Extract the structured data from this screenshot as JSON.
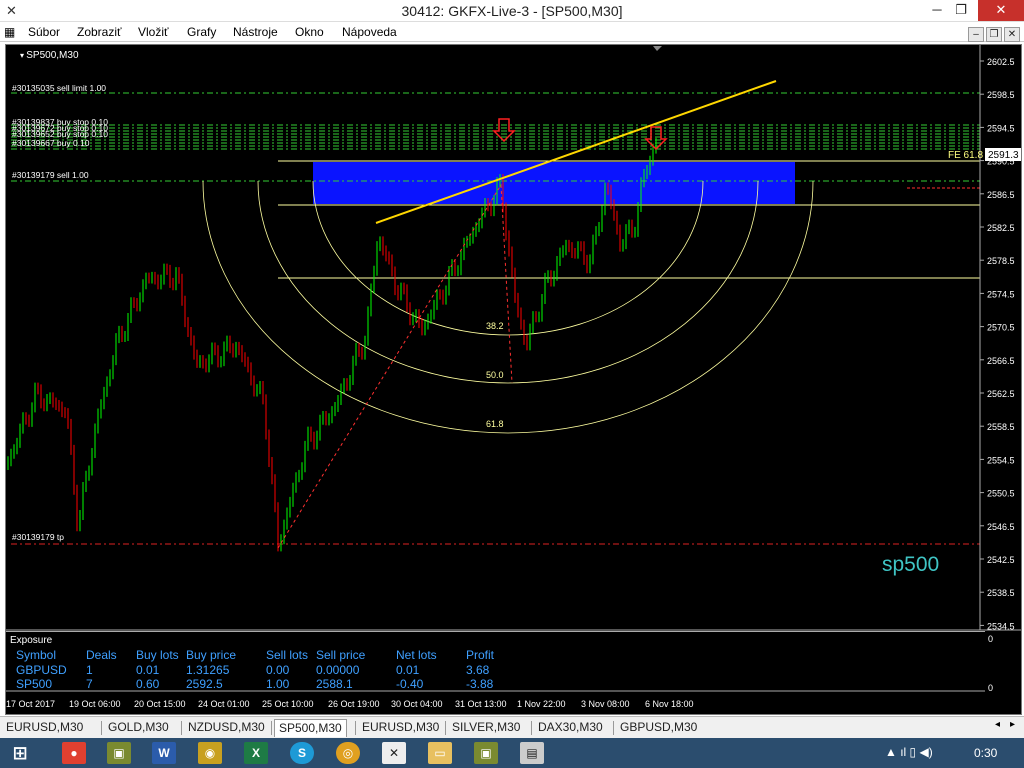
{
  "window": {
    "title": "30412: GKFX-Live-3 - [SP500,M30]",
    "minimize": "─",
    "restore": "❐",
    "close": "✕"
  },
  "menu": [
    "Súbor",
    "Zobraziť",
    "Vložiť",
    "Grafy",
    "Nástroje",
    "Okno",
    "Nápoveda"
  ],
  "chart": {
    "symbol": "SP500,M30",
    "watermark": "sp500",
    "price_tag": "2591.3",
    "fe_label": "FE 61.8",
    "orders": {
      "sell_limit": "#30135035 sell limit 1.00",
      "buy_stop_1": "#30139837 buy stop 0.10",
      "buy_stop_2": "#30139672 buy stop 0.10",
      "buy_stop_3": "#30139652 buy stop 0.10",
      "buy_1": "#30139667 buy 0.10",
      "sell": "#30139179 sell 1.00",
      "tp": "#30139179 tp"
    },
    "fib_labels": [
      "38.2",
      "50.0",
      "61.8"
    ],
    "price_axis": [
      "2602.5",
      "2598.5",
      "2594.5",
      "2590.5",
      "2586.5",
      "2582.5",
      "2578.5",
      "2574.5",
      "2570.5",
      "2566.5",
      "2562.5",
      "2558.5",
      "2554.5",
      "2550.5",
      "2546.5",
      "2542.5",
      "2538.5",
      "2534.5"
    ],
    "time_axis": [
      "17 Oct 2017",
      "19 Oct 06:00",
      "20 Oct 15:00",
      "24 Oct 01:00",
      "25 Oct 10:00",
      "26 Oct 19:00",
      "30 Oct 04:00",
      "31 Oct 13:00",
      "1 Nov 22:00",
      "3 Nov 08:00",
      "6 Nov 18:00"
    ],
    "subaxis": [
      "0",
      "0"
    ],
    "colors": {
      "bull": "#00ff00",
      "bear": "#ff0000",
      "zone": "#0a14ff",
      "trend": "#ffd700",
      "fib": "#ffffa0"
    }
  },
  "exposure": {
    "title": "Exposure",
    "headers": [
      "Symbol",
      "Deals",
      "Buy lots",
      "Buy price",
      "Sell lots",
      "Sell price",
      "Net lots",
      "Profit"
    ],
    "rows": [
      [
        "GBPUSD",
        "1",
        "0.01",
        "1.31265",
        "0.00",
        "0.00000",
        "0.01",
        "3.68"
      ],
      [
        "SP500",
        "7",
        "0.60",
        "2592.5",
        "1.00",
        "2588.1",
        "-0.40",
        "-3.88"
      ]
    ]
  },
  "tabs": [
    "EURUSD,M30",
    "GOLD,M30",
    "NZDUSD,M30",
    "SP500,M30",
    "EURUSD,M30",
    "SILVER,M30",
    "DAX30,M30",
    "GBPUSD,M30"
  ],
  "active_tab": 3,
  "taskbar": {
    "clock": "0:30"
  }
}
